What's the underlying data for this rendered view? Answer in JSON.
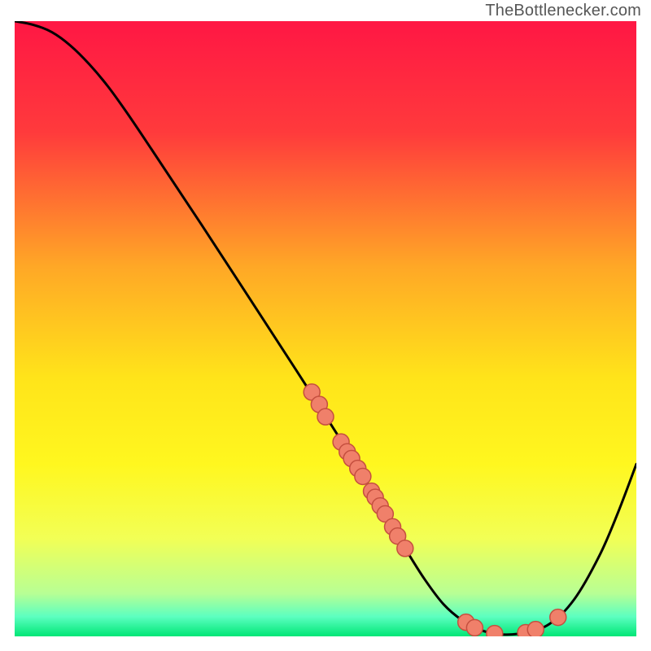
{
  "attribution": "TheBottlenecker.com",
  "chart_data": {
    "type": "line",
    "title": "",
    "xlabel": "",
    "ylabel": "",
    "xlim": [
      0,
      100
    ],
    "ylim": [
      0,
      100
    ],
    "grid": false,
    "gradient": {
      "stops": [
        {
          "offset": 0.0,
          "color": "#ff1744"
        },
        {
          "offset": 0.18,
          "color": "#ff3a3c"
        },
        {
          "offset": 0.4,
          "color": "#ffa826"
        },
        {
          "offset": 0.58,
          "color": "#ffe41a"
        },
        {
          "offset": 0.72,
          "color": "#fff71f"
        },
        {
          "offset": 0.84,
          "color": "#f2ff55"
        },
        {
          "offset": 0.93,
          "color": "#b8ff94"
        },
        {
          "offset": 0.968,
          "color": "#5cffc0"
        },
        {
          "offset": 1.0,
          "color": "#00e676"
        }
      ]
    },
    "curve": [
      {
        "x": 0.0,
        "y": 100.0
      },
      {
        "x": 3.0,
        "y": 99.4
      },
      {
        "x": 6.0,
        "y": 98.2
      },
      {
        "x": 9.0,
        "y": 96.0
      },
      {
        "x": 12.0,
        "y": 93.0
      },
      {
        "x": 15.0,
        "y": 89.4
      },
      {
        "x": 18.0,
        "y": 85.2
      },
      {
        "x": 22.0,
        "y": 79.2
      },
      {
        "x": 30.0,
        "y": 67.0
      },
      {
        "x": 40.0,
        "y": 51.5
      },
      {
        "x": 48.0,
        "y": 39.0
      },
      {
        "x": 55.0,
        "y": 27.8
      },
      {
        "x": 60.0,
        "y": 19.2
      },
      {
        "x": 63.0,
        "y": 14.0
      },
      {
        "x": 66.0,
        "y": 9.2
      },
      {
        "x": 69.0,
        "y": 5.2
      },
      {
        "x": 72.0,
        "y": 2.6
      },
      {
        "x": 75.0,
        "y": 1.0
      },
      {
        "x": 78.5,
        "y": 0.3
      },
      {
        "x": 82.0,
        "y": 0.6
      },
      {
        "x": 86.0,
        "y": 2.0
      },
      {
        "x": 90.0,
        "y": 6.0
      },
      {
        "x": 94.0,
        "y": 13.0
      },
      {
        "x": 97.0,
        "y": 20.0
      },
      {
        "x": 100.0,
        "y": 28.0
      }
    ],
    "points": [
      {
        "x": 47.8,
        "y": 39.7
      },
      {
        "x": 49.0,
        "y": 37.7
      },
      {
        "x": 50.0,
        "y": 35.7
      },
      {
        "x": 52.5,
        "y": 31.6
      },
      {
        "x": 53.5,
        "y": 30.0
      },
      {
        "x": 54.2,
        "y": 28.9
      },
      {
        "x": 55.2,
        "y": 27.3
      },
      {
        "x": 56.0,
        "y": 26.0
      },
      {
        "x": 57.4,
        "y": 23.6
      },
      {
        "x": 58.0,
        "y": 22.6
      },
      {
        "x": 58.8,
        "y": 21.2
      },
      {
        "x": 59.6,
        "y": 19.9
      },
      {
        "x": 60.8,
        "y": 17.8
      },
      {
        "x": 61.6,
        "y": 16.3
      },
      {
        "x": 62.8,
        "y": 14.3
      },
      {
        "x": 72.6,
        "y": 2.3
      },
      {
        "x": 74.0,
        "y": 1.4
      },
      {
        "x": 77.2,
        "y": 0.45
      },
      {
        "x": 82.2,
        "y": 0.6
      },
      {
        "x": 83.8,
        "y": 1.1
      },
      {
        "x": 87.4,
        "y": 3.1
      }
    ],
    "point_style": {
      "fill": "#f0806a",
      "stroke": "#c54f3f",
      "r": 10
    },
    "line_style": {
      "stroke": "#000000",
      "width": 3
    }
  }
}
